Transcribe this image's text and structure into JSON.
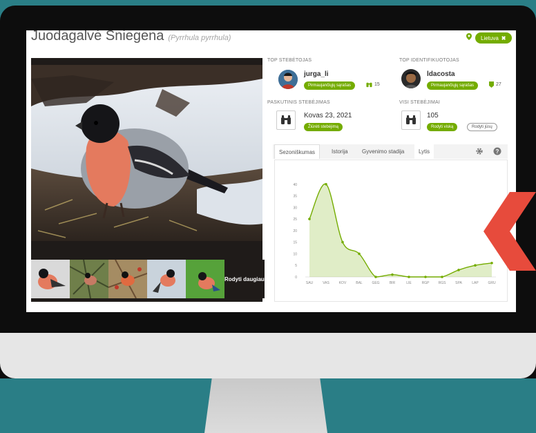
{
  "page": {
    "common_name": "Juodagalvė Sniegena",
    "scientific_name": "(Pyrrhula pyrrhula)",
    "place_chip": "Lietuva",
    "colors": {
      "accent": "#74ac00",
      "background": "#2a7e86",
      "arrow": "#e74b3c"
    }
  },
  "photos": {
    "more_label": "Rodyti daugiau",
    "thumbnails": [
      "bullfinch-thumb-1",
      "bullfinch-thumb-2",
      "bullfinch-thumb-3",
      "bullfinch-thumb-4",
      "bullfinch-thumb-5"
    ]
  },
  "top_observer": {
    "label": "TOP STEBĖTOJAS",
    "name": "jurga_li",
    "badge": "Pirmaujančiųjų sąrašas",
    "count": "15"
  },
  "top_identifier": {
    "label": "TOP IDENTIFIKUOTOJAS",
    "name": "ldacosta",
    "badge": "Pirmaujančiųjų sąrašas",
    "count": "27"
  },
  "last_observation": {
    "label": "PASKUTINIS STEBĖJIMAS",
    "date": "Kovas 23, 2021",
    "button": "Žiūrėti stebėjimą"
  },
  "all_observations": {
    "label": "VISI STEBĖJIMAI",
    "count": "105",
    "button_all": "Rodyti viską",
    "button_yours": "Rodyti jūsų"
  },
  "tabs": [
    "Sezoniškumas",
    "Istorija",
    "Gyvenimo stadija",
    "Lytis"
  ],
  "chart_data": {
    "type": "area",
    "categories": [
      "SAU",
      "VAS",
      "KOV",
      "BAL",
      "GEG",
      "BIR",
      "LIE",
      "RGP",
      "RGS",
      "SPA",
      "LAP",
      "GRU"
    ],
    "values": [
      25,
      40,
      15,
      10,
      0,
      1,
      0,
      0,
      0,
      3,
      5,
      6
    ],
    "y_ticks": [
      "0",
      "5",
      "10",
      "15",
      "20",
      "25",
      "30",
      "35",
      "40"
    ],
    "ylim": [
      0,
      45
    ],
    "title": "",
    "xlabel": "",
    "ylabel": "",
    "color": "#74ac00"
  }
}
